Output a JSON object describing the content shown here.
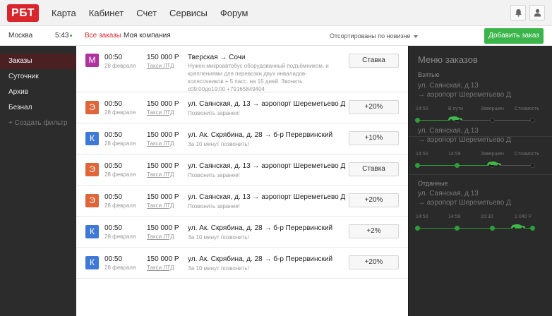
{
  "header": {
    "logo": "РБТ",
    "nav": [
      "Карта",
      "Кабинет",
      "Счет",
      "Сервисы",
      "Форум"
    ],
    "icons": [
      "bell-icon",
      "user-icon"
    ]
  },
  "subbar": {
    "city": "Москва",
    "time": "5:43",
    "tab_all": "Все заказы",
    "tab_company": "Моя компания",
    "sort": "Отсортированы по новизне",
    "add_button": "Добавить заказ"
  },
  "sidebar": {
    "items": [
      "Заказы",
      "Суточник",
      "Архив",
      "Безнал"
    ],
    "create_filter": "+ Создать фильтр"
  },
  "orders": [
    {
      "badge": "М",
      "badge_color": "#b0329e",
      "time": "00:50",
      "date": "28 февраля",
      "price": "150 000 Р",
      "company": "Такси ЛТД",
      "route": "Тверская → Сочи",
      "note": "Нужен микроавтобус оборудованный подъёмником, и креплениями для перевозки двух инвалидов-колясочников + 5 пасс. на 15 дней. Звонить с09:00до19:00 +79165849404",
      "action": "Ставка"
    },
    {
      "badge": "Э",
      "badge_color": "#e0663a",
      "time": "00:50",
      "date": "28 февраля",
      "price": "150 000 Р",
      "company": "Такси ЛТД",
      "route": "ул. Саянская, д. 13 → аэропорт Шереметьево Д",
      "note": "Позвонить заранее!",
      "action": "+20%"
    },
    {
      "badge": "К",
      "badge_color": "#3f79d8",
      "time": "00:50",
      "date": "28 февраля",
      "price": "150 000 Р",
      "company": "Такси ЛТД",
      "route": "ул. Ак. Скрябина, д. 28 → б-р Перервинский",
      "note": "За 10 минут позвонить!",
      "action": "+10%"
    },
    {
      "badge": "Э",
      "badge_color": "#e0663a",
      "time": "00:50",
      "date": "28 февраля",
      "price": "150 000 Р",
      "company": "Такси ЛТД",
      "route": "ул. Саянская, д. 13 → аэропорт Шереметьево Д",
      "note": "Позвонить заранее!",
      "action": "Ставка"
    },
    {
      "badge": "Э",
      "badge_color": "#e0663a",
      "time": "00:50",
      "date": "28 февраля",
      "price": "150 000 Р",
      "company": "Такси ЛТД",
      "route": "ул. Саянская, д. 13 → аэропорт Шереметьево Д",
      "note": "Позвонить заранее!",
      "action": "+20%"
    },
    {
      "badge": "К",
      "badge_color": "#3f79d8",
      "time": "00:50",
      "date": "28 февраля",
      "price": "150 000 Р",
      "company": "Такси ЛТД",
      "route": "ул. Ак. Скрябина, д. 28 → б-р Перервинский",
      "note": "За 10 минут позвонить!",
      "action": "+2%"
    },
    {
      "badge": "К",
      "badge_color": "#3f79d8",
      "time": "00:50",
      "date": "28 февраля",
      "price": "150 000 Р",
      "company": "Такси ЛТД",
      "route": "ул. Ак. Скрябина, д. 28 → б-р Перервинский",
      "note": "За 10 минут позвонить!",
      "action": "+20%"
    }
  ],
  "panel": {
    "title": "Меню заказов",
    "taken_label": "Взятые",
    "given_label": "Отданные",
    "tracks": [
      {
        "route1": "ул. Саянская, д.13",
        "route2": "→ аэропорт Шереметьево Д",
        "labels": [
          "14:50",
          "В пути",
          "Завершен",
          "Стоимость"
        ],
        "progress": 0.33
      },
      {
        "route1": "ул. Саянская, д.13",
        "route2": "→ аэропорт Шереметьево Д",
        "labels": [
          "14:50",
          "14:59",
          "Завершен",
          "Стоимость"
        ],
        "progress": 0.66
      },
      {
        "route1": "ул. Саянская, д.13",
        "route2": "→ аэропорт Шереметьево Д",
        "labels": [
          "14:50",
          "14:59",
          "15:30",
          "1 040 Р"
        ],
        "progress": 1.0
      }
    ]
  }
}
